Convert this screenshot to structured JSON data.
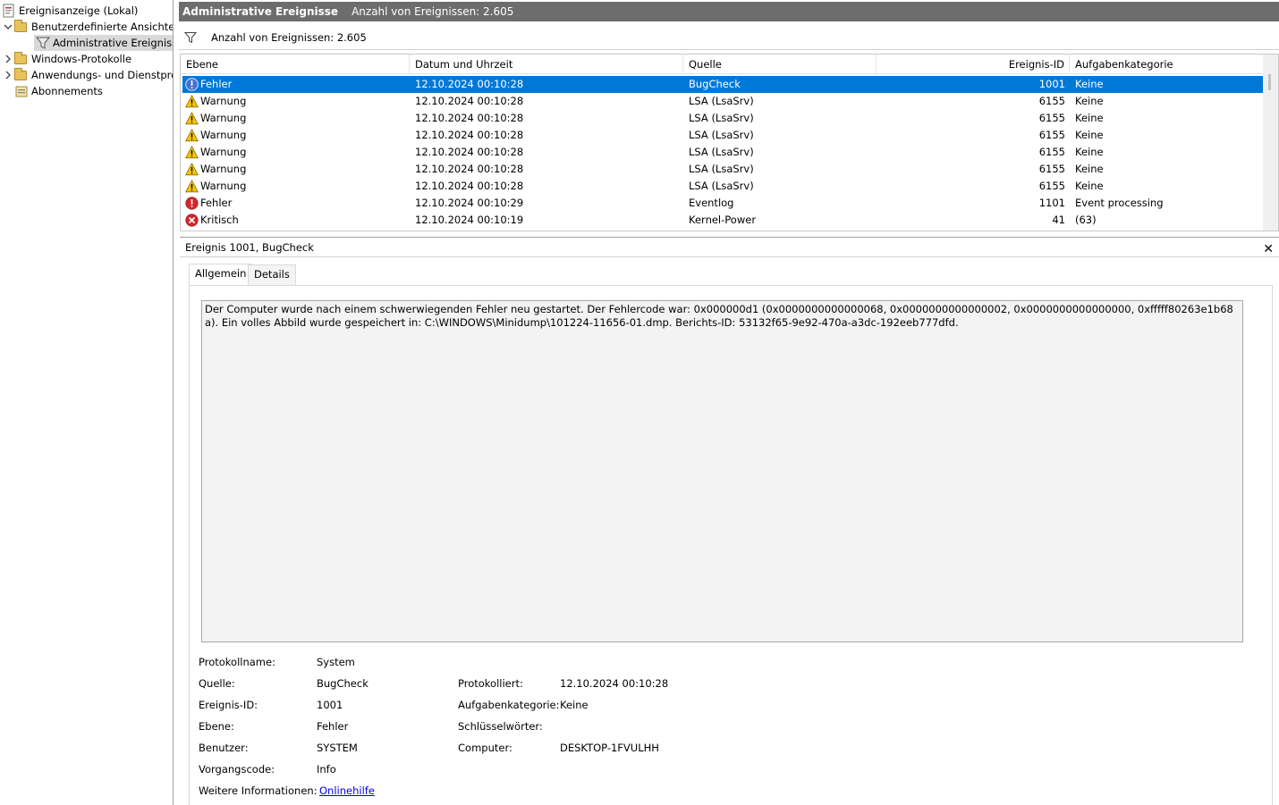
{
  "tree": {
    "root": "Ereignisanzeige (Lokal)",
    "custom_views": "Benutzerdefinierte Ansichten",
    "admin_events": "Administrative Ereignisse",
    "windows_logs": "Windows-Protokolle",
    "app_logs": "Anwendungs- und Dienstprotokolle",
    "subscriptions": "Abonnements"
  },
  "header": {
    "title": "Administrative Ereignisse",
    "count": "Anzahl von Ereignissen: 2.605"
  },
  "subbar": {
    "text": "Anzahl von Ereignissen: 2.605"
  },
  "grid": {
    "columns": [
      "Ebene",
      "Datum und Uhrzeit",
      "Quelle",
      "Ereignis-ID",
      "Aufgabenkategorie"
    ],
    "rows": [
      {
        "level": "Fehler",
        "icon": "info-error-icon",
        "date": "12.10.2024 00:10:28",
        "source": "BugCheck",
        "id": "1001",
        "category": "Keine"
      },
      {
        "level": "Warnung",
        "icon": "warning-icon",
        "date": "12.10.2024 00:10:28",
        "source": "LSA (LsaSrv)",
        "id": "6155",
        "category": "Keine"
      },
      {
        "level": "Warnung",
        "icon": "warning-icon",
        "date": "12.10.2024 00:10:28",
        "source": "LSA (LsaSrv)",
        "id": "6155",
        "category": "Keine"
      },
      {
        "level": "Warnung",
        "icon": "warning-icon",
        "date": "12.10.2024 00:10:28",
        "source": "LSA (LsaSrv)",
        "id": "6155",
        "category": "Keine"
      },
      {
        "level": "Warnung",
        "icon": "warning-icon",
        "date": "12.10.2024 00:10:28",
        "source": "LSA (LsaSrv)",
        "id": "6155",
        "category": "Keine"
      },
      {
        "level": "Warnung",
        "icon": "warning-icon",
        "date": "12.10.2024 00:10:28",
        "source": "LSA (LsaSrv)",
        "id": "6155",
        "category": "Keine"
      },
      {
        "level": "Warnung",
        "icon": "warning-icon",
        "date": "12.10.2024 00:10:28",
        "source": "LSA (LsaSrv)",
        "id": "6155",
        "category": "Keine"
      },
      {
        "level": "Fehler",
        "icon": "error-icon",
        "date": "12.10.2024 00:10:29",
        "source": "Eventlog",
        "id": "1101",
        "category": "Event processing"
      },
      {
        "level": "Kritisch",
        "icon": "critical-icon",
        "date": "12.10.2024 00:10:19",
        "source": "Kernel-Power",
        "id": "41",
        "category": "(63)"
      }
    ]
  },
  "detail": {
    "title": "Ereignis 1001, BugCheck",
    "close": "✕",
    "tab_general": "Allgemein",
    "tab_details": "Details",
    "description": "Der Computer wurde nach einem schwerwiegenden Fehler neu gestartet. Der Fehlercode war: 0x000000d1 (0x0000000000000068, 0x0000000000000002, 0x0000000000000000, 0xfffff80263e1b68a). Ein volles Abbild wurde gespeichert in: C:\\WINDOWS\\Minidump\\101224-11656-01.dmp. Berichts-ID: 53132f65-9e92-470a-a3dc-192eeb777dfd.",
    "props": {
      "log_name_label": "Protokollname:",
      "log_name": "System",
      "source_label": "Quelle:",
      "source": "BugCheck",
      "logged_label": "Protokolliert:",
      "logged": "12.10.2024 00:10:28",
      "event_id_label": "Ereignis-ID:",
      "event_id": "1001",
      "task_cat_label": "Aufgabenkategorie:",
      "task_cat": "Keine",
      "level_label": "Ebene:",
      "level": "Fehler",
      "keywords_label": "Schlüsselwörter:",
      "user_label": "Benutzer:",
      "user": "SYSTEM",
      "computer_label": "Computer:",
      "computer": "DESKTOP-1FVULHH",
      "opcode_label": "Vorgangscode:",
      "opcode": "Info",
      "more_info_label": "Weitere Informationen:",
      "more_info_link": "Onlinehilfe"
    }
  },
  "colors": {
    "selection": "#0078d7",
    "header_bg": "#6d6d6d",
    "link": "#0000ee"
  }
}
